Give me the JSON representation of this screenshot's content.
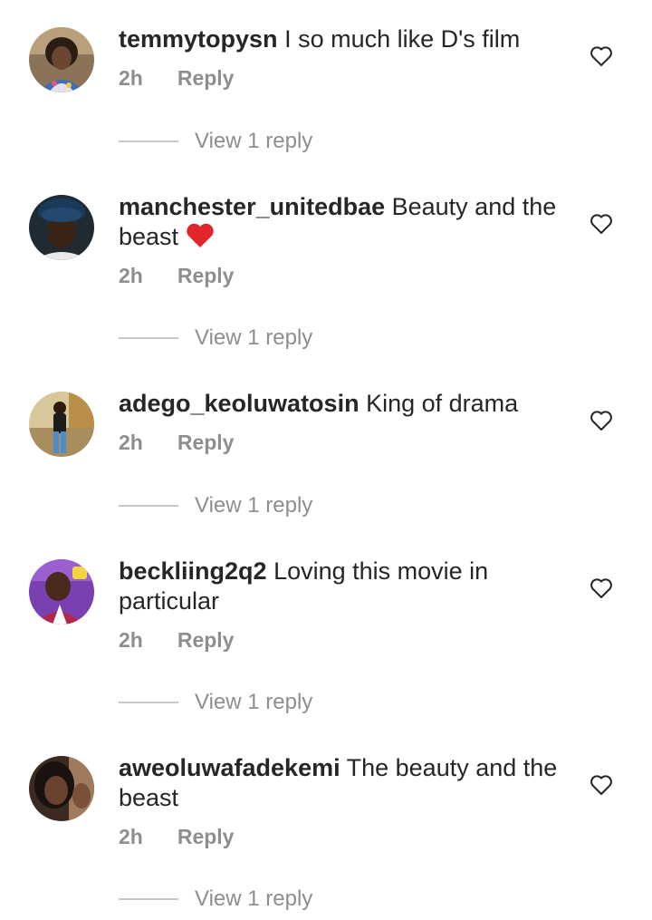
{
  "comments": [
    {
      "username": "temmytopysn",
      "text": "I so much like D's film",
      "time": "2h",
      "reply_label": "Reply",
      "view_replies": "View 1 reply"
    },
    {
      "username": "manchester_unitedbae",
      "text": "Beauty and the beast",
      "emoji": "red-heart-emoji",
      "time": "2h",
      "reply_label": "Reply",
      "view_replies": "View 1 reply"
    },
    {
      "username": "adego_keoluwatosin",
      "text": "King of drama",
      "time": "2h",
      "reply_label": "Reply",
      "view_replies": "View 1 reply"
    },
    {
      "username": "beckliing2q2",
      "text": "Loving this movie in particular",
      "time": "2h",
      "reply_label": "Reply",
      "view_replies": "View 1 reply"
    },
    {
      "username": "aweoluwafadekemi",
      "text": "The beauty and the beast",
      "time": "2h",
      "reply_label": "Reply",
      "view_replies": "View 1 reply"
    }
  ],
  "colors": {
    "text": "#262626",
    "secondary": "#8e8e8e",
    "divider": "#c7c7c7",
    "emoji_heart": "#e0262a"
  },
  "icons": {
    "like": "heart-outline-icon"
  }
}
